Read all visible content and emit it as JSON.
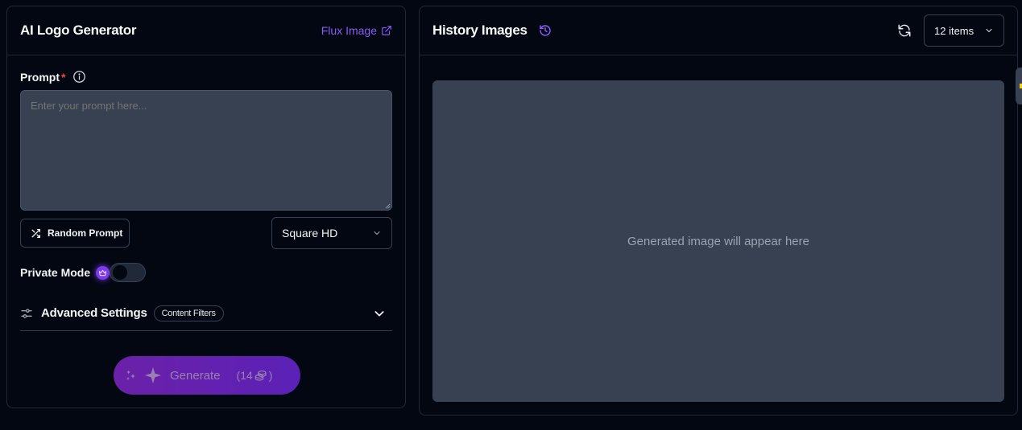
{
  "left_panel": {
    "title": "AI Logo Generator",
    "link_label": "Flux Image",
    "prompt_label": "Prompt",
    "required_mark": "*",
    "prompt_placeholder": "Enter your prompt here...",
    "prompt_value": "",
    "random_prompt_label": "Random Prompt",
    "size_select_value": "Square HD",
    "private_mode_label": "Private Mode",
    "private_mode_on": false,
    "advanced_settings_label": "Advanced Settings",
    "content_filters_badge": "Content Filters",
    "generate_label": "Generate",
    "generate_cost_open": "(14",
    "generate_cost_close": ")"
  },
  "right_panel": {
    "title": "History Images",
    "items_select_value": "12 items",
    "image_placeholder": "Generated image will appear here"
  },
  "colors": {
    "accent": "#8b5cf6",
    "background": "#030712",
    "surface": "#374151",
    "border": "#1f2937",
    "required": "#ef4444"
  },
  "icons": {
    "external_link": "external-link-icon",
    "info": "info-icon",
    "shuffle": "shuffle-icon",
    "chevron": "chevron-down-icon",
    "crown": "crown-icon",
    "sliders": "sliders-icon",
    "sparkle": "sparkle-icon",
    "coins": "coins-icon",
    "history": "history-icon",
    "refresh": "refresh-icon"
  }
}
